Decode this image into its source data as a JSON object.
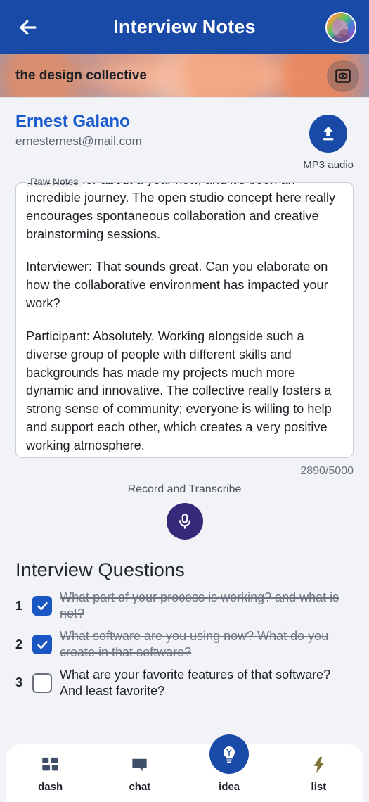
{
  "appbar": {
    "back_icon": "arrow-left-icon",
    "title": "Interview Notes",
    "avatar_alt": "user-avatar"
  },
  "banner": {
    "title": "the design collective",
    "preview_icon": "eye-preview-icon"
  },
  "person": {
    "name": "Ernest Galano",
    "email": "ernesternest@mail.com",
    "upload_icon": "upload-arrow-icon",
    "upload_label": "MP3 audio"
  },
  "notes": {
    "legend": "Raw Notes",
    "paragraphs": [
      "collective for about a year now, and it's been an incredible journey. The open studio concept here really encourages spontaneous collaboration and creative brainstorming sessions.",
      "Interviewer: That sounds great. Can you elaborate on how the collaborative environment has impacted your work?",
      "Participant: Absolutely. Working alongside such a diverse group of people with different skills and backgrounds has made my projects much more dynamic and innovative. The collective really fosters a strong sense of community; everyone is willing to help and support each other, which creates a very positive working atmosphere."
    ],
    "char_count": "2890/5000"
  },
  "record": {
    "label": "Record and Transcribe",
    "mic_icon": "microphone-icon"
  },
  "questions": {
    "title": "Interview Questions",
    "items": [
      {
        "num": "1",
        "text": "What part of your process is working? and what is not?",
        "checked": true
      },
      {
        "num": "2",
        "text": "What software are you using now? What do you create in that software?",
        "checked": true
      },
      {
        "num": "3",
        "text": "What are your favorite features of that software? And least favorite?",
        "checked": false
      }
    ]
  },
  "bottom_nav": {
    "items": [
      {
        "label": "dash",
        "icon": "grid-dashboard-icon"
      },
      {
        "label": "chat",
        "icon": "speech-bubble-icon"
      },
      {
        "label": "idea",
        "icon": "lightbulb-icon"
      },
      {
        "label": "list",
        "icon": "lightning-bolt-icon"
      }
    ]
  },
  "colors": {
    "header_blue": "#1a4aa8",
    "link_blue": "#1a5bd0",
    "checkbox_blue": "#1a56c4",
    "mic_purple": "#352a7a",
    "nav_icon_slate": "#3d4e69",
    "bolt_olive": "#7d7035",
    "page_bg": "#f1f3f7"
  }
}
